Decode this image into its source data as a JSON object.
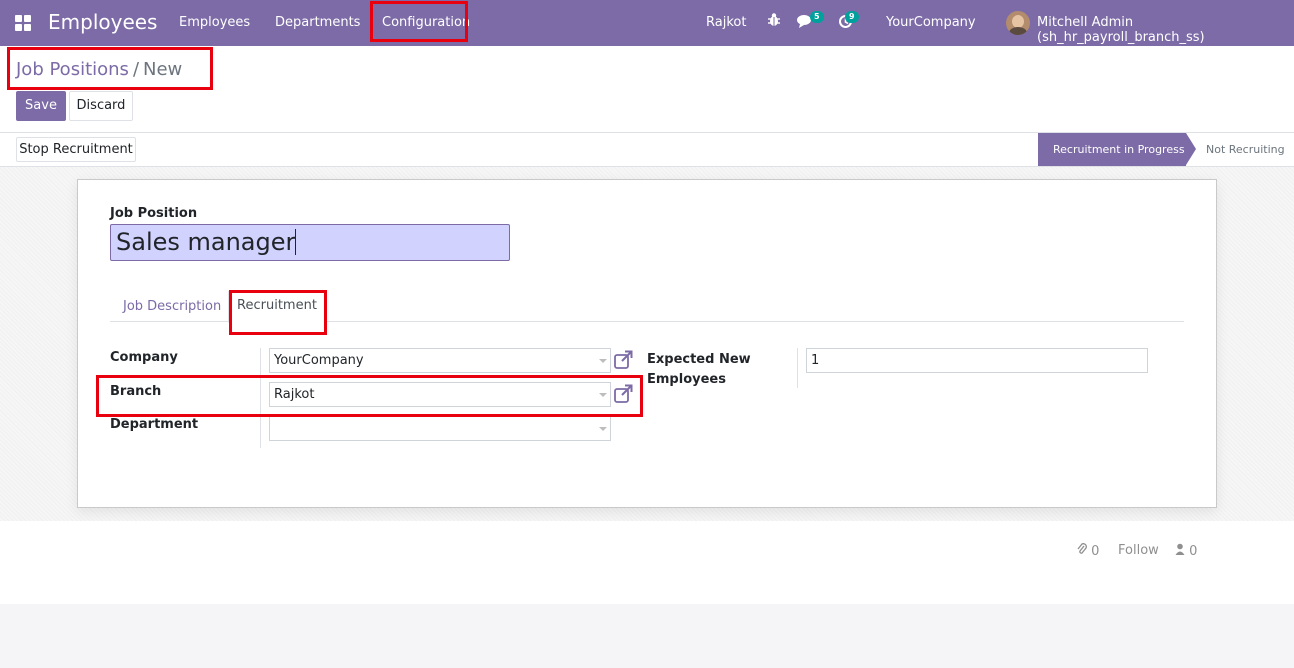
{
  "navbar": {
    "app_title": "Employees",
    "menu": [
      "Employees",
      "Departments",
      "Configuration"
    ],
    "branch": "Rajkot",
    "messages_count": "5",
    "activities_count": "9",
    "company": "YourCompany",
    "user": "Mitchell Admin (sh_hr_payroll_branch_ss)"
  },
  "breadcrumb": {
    "parent": "Job Positions",
    "separator": "/",
    "current": "New"
  },
  "buttons": {
    "save": "Save",
    "discard": "Discard",
    "stop_recruitment": "Stop Recruitment"
  },
  "statusbar": {
    "active_stage": "Recruitment in Progress",
    "other_stage": "Not Recruiting"
  },
  "form": {
    "job_position_label": "Job Position",
    "job_position_value": "Sales manager",
    "tabs": [
      "Job Description",
      "Recruitment"
    ],
    "active_tab": "Recruitment",
    "company_label": "Company",
    "company_value": "YourCompany",
    "branch_label": "Branch",
    "branch_value": "Rajkot",
    "department_label": "Department",
    "department_value": "",
    "expected_label_line1": "Expected New",
    "expected_label_line2": "Employees",
    "expected_value": "1"
  },
  "chatter": {
    "attachments": "0",
    "follow": "Follow",
    "followers": "0"
  },
  "colors": {
    "brand": "#7c6ba6",
    "accent": "#00a09d",
    "annotation": "#e8000f"
  }
}
